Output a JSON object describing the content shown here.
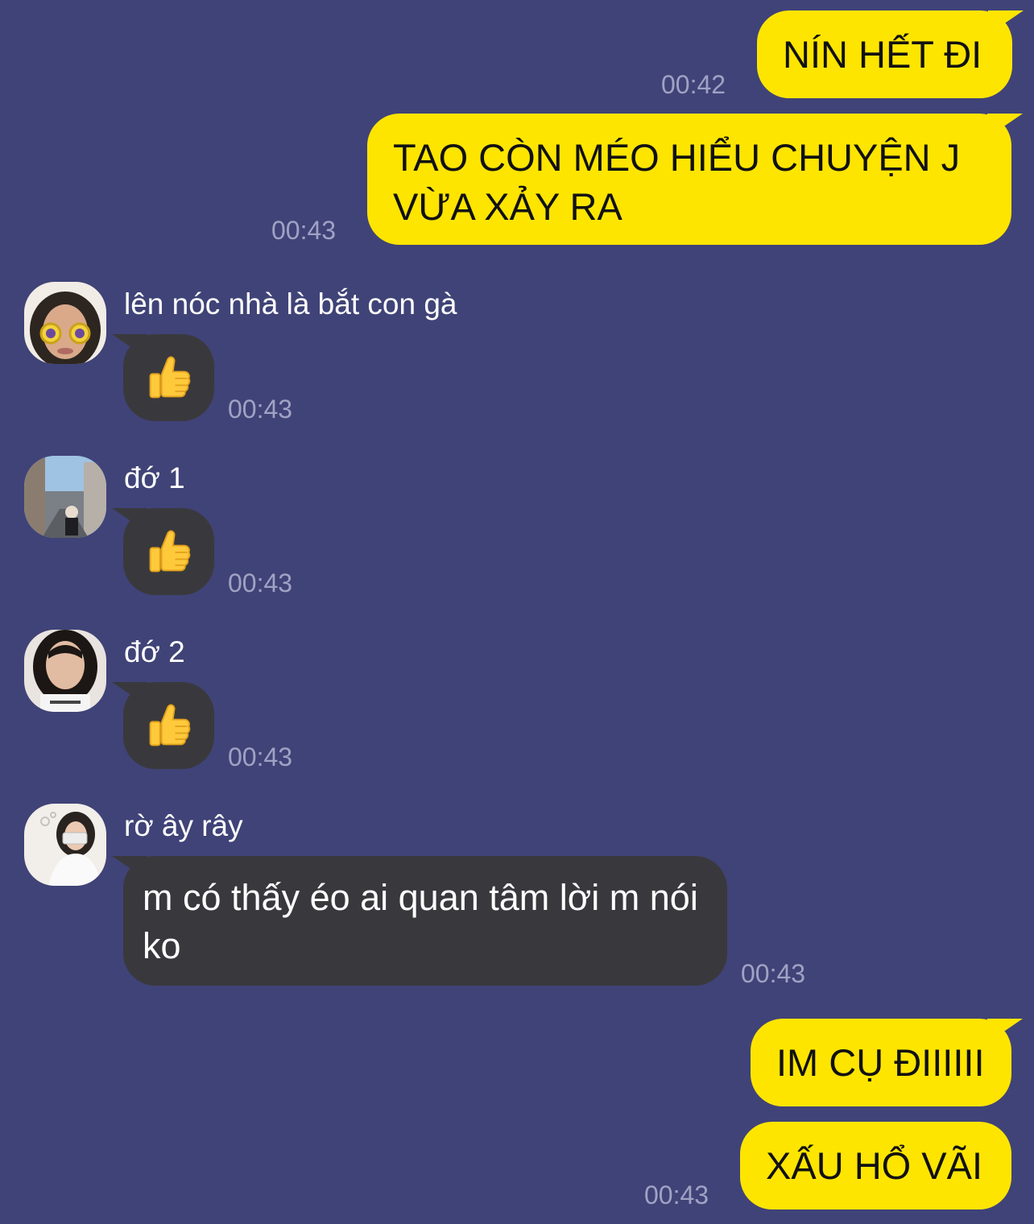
{
  "messages": {
    "m1": {
      "text": "NÍN HẾT ĐI",
      "time": "00:42"
    },
    "m2": {
      "text": "TAO CÒN MÉO HIỂU CHUYỆN J VỪA XẢY RA",
      "time": "00:43"
    },
    "m3": {
      "sender": "lên nóc nhà là bắt con gà",
      "emoji": "thumbs-up-icon",
      "time": "00:43"
    },
    "m4": {
      "sender": "đớ 1",
      "emoji": "thumbs-up-icon",
      "time": "00:43"
    },
    "m5": {
      "sender": "đớ 2",
      "emoji": "thumbs-up-icon",
      "time": "00:43"
    },
    "m6": {
      "sender": "rờ ây rây",
      "text": "m có thấy éo ai quan tâm lời m nói ko",
      "time": "00:43"
    },
    "m7": {
      "text": "IM CỤ ĐIIIIII"
    },
    "m8": {
      "text": "XẤU HỔ VÃI",
      "time": "00:43"
    }
  },
  "colors": {
    "background": "#404377",
    "outgoing_bubble": "#fee500",
    "incoming_bubble": "#39393d",
    "timestamp": "#a0a2c4"
  }
}
